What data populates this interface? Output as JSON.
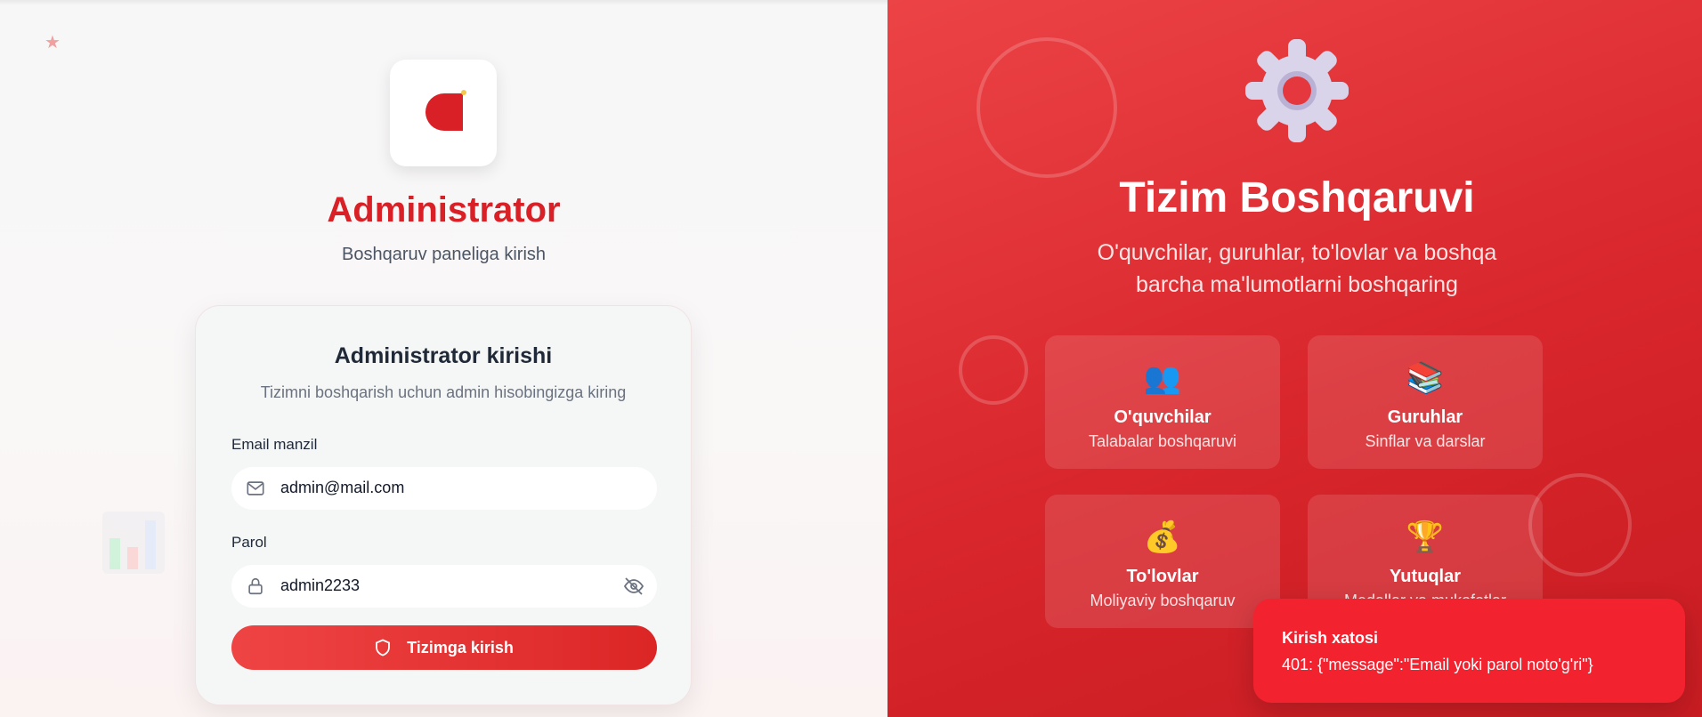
{
  "left": {
    "brand": {
      "title": "Administrator",
      "subtitle": "Boshqaruv paneliga kirish",
      "logo_icon": "admin-logo-icon"
    },
    "login_card": {
      "title": "Administrator kirishi",
      "subtitle": "Tizimni boshqarish uchun admin hisobingizga kiring",
      "email_label": "Email manzil",
      "email_value": "admin@mail.com",
      "password_label": "Parol",
      "password_value": "admin2233",
      "submit_label": "Tizimga kirish"
    }
  },
  "right": {
    "title": "Tizim Boshqaruvi",
    "subtitle": "O'quvchilar, guruhlar, to'lovlar va boshqa barcha ma'lumotlarni boshqaring",
    "features": [
      {
        "emoji": "👥",
        "title": "O'quvchilar",
        "subtitle": "Talabalar boshqaruvi"
      },
      {
        "emoji": "📚",
        "title": "Guruhlar",
        "subtitle": "Sinflar va darslar"
      },
      {
        "emoji": "💰",
        "title": "To'lovlar",
        "subtitle": "Moliyaviy boshqaruv"
      },
      {
        "emoji": "🏆",
        "title": "Yutuqlar",
        "subtitle": "Medallar va mukofotlar"
      }
    ]
  },
  "toast": {
    "title": "Kirish xatosi",
    "message": "401: {\"message\":\"Email yoki parol noto'g'ri\"}"
  },
  "colors": {
    "brand_red": "#d92027",
    "panel_red": "#d8262c",
    "toast_red": "#f2222f"
  }
}
